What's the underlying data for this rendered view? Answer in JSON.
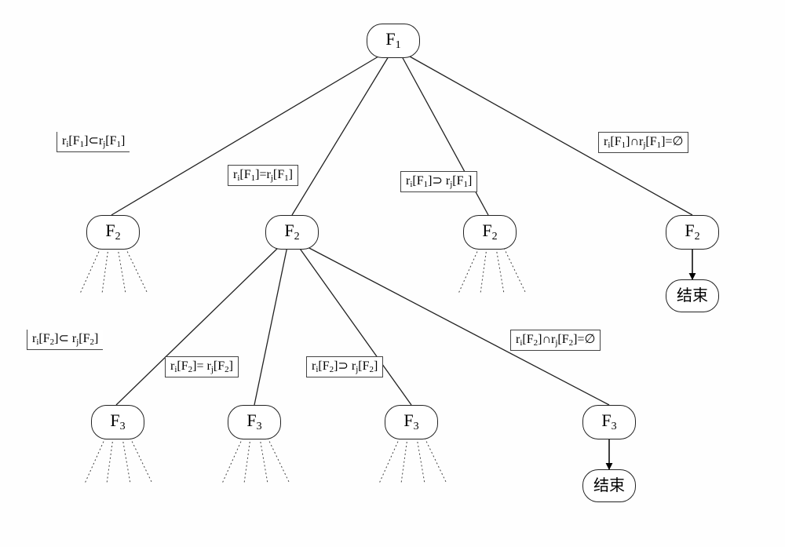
{
  "nodes": {
    "root": {
      "label_main": "F",
      "label_sub": "1"
    },
    "l1a": {
      "label_main": "F",
      "label_sub": "2"
    },
    "l1b": {
      "label_main": "F",
      "label_sub": "2"
    },
    "l1c": {
      "label_main": "F",
      "label_sub": "2"
    },
    "l1d": {
      "label_main": "F",
      "label_sub": "2"
    },
    "l1d_end": {
      "label_plain": "结束"
    },
    "l2a": {
      "label_main": "F",
      "label_sub": "3"
    },
    "l2b": {
      "label_main": "F",
      "label_sub": "3"
    },
    "l2c": {
      "label_main": "F",
      "label_sub": "3"
    },
    "l2d": {
      "label_main": "F",
      "label_sub": "3"
    },
    "l2d_end": {
      "label_plain": "结束"
    }
  },
  "edge_labels": {
    "e_root_a": {
      "html": "r<sub>i</sub>[F<sub>1</sub>]⊂r<sub>j</sub>[F<sub>1</sub>]"
    },
    "e_root_b": {
      "html": "r<sub>i</sub>[F<sub>1</sub>]=r<sub>j</sub>[F<sub>1</sub>]"
    },
    "e_root_c": {
      "html": "r<sub>i</sub>[F<sub>1</sub>]⊃ r<sub>j</sub>[F<sub>1</sub>]"
    },
    "e_root_d": {
      "html": "r<sub>i</sub>[F<sub>1</sub>]∩r<sub>j</sub>[F<sub>1</sub>]=∅"
    },
    "e_b_a": {
      "html": "r<sub>i</sub>[F<sub>2</sub>]⊂ r<sub>j</sub>[F<sub>2</sub>]"
    },
    "e_b_b": {
      "html": "r<sub>i</sub>[F<sub>2</sub>]= r<sub>j</sub>[F<sub>2</sub>]"
    },
    "e_b_c": {
      "html": "r<sub>i</sub>[F<sub>2</sub>]⊃ r<sub>j</sub>[F<sub>2</sub>]"
    },
    "e_b_d": {
      "html": "r<sub>i</sub>[F<sub>2</sub>]∩r<sub>j</sub>[F<sub>2</sub>]=∅"
    }
  }
}
